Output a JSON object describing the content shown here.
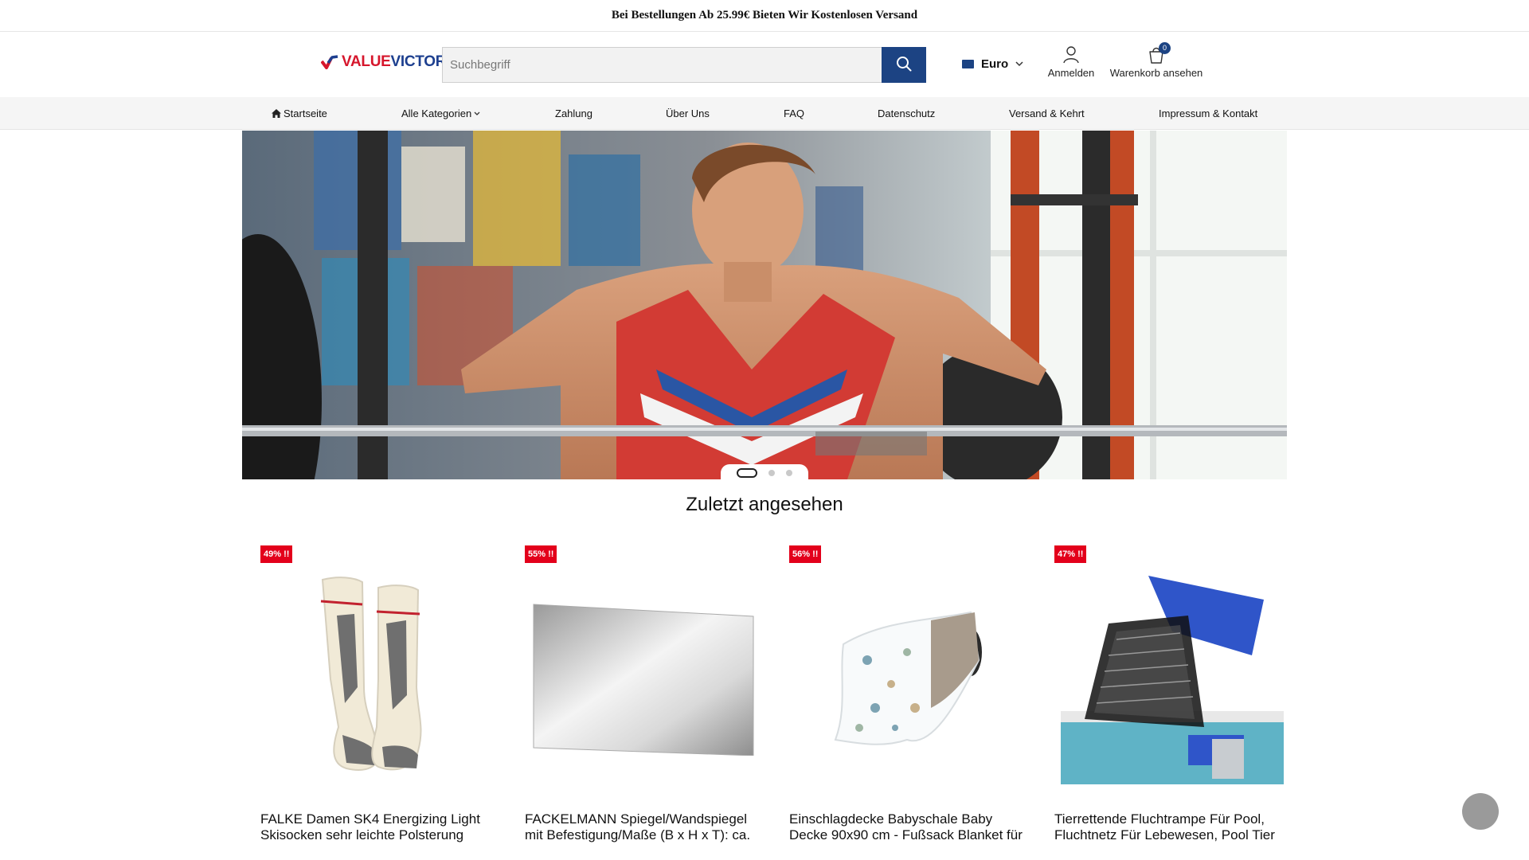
{
  "announcement": {
    "text": "Bei Bestellungen Ab 25.99€ Bieten Wir Kostenlosen Versand"
  },
  "header": {
    "logo": {
      "part1": "VALUE",
      "part2": "VICTOR"
    },
    "search": {
      "placeholder": "Suchbegriff",
      "value": ""
    },
    "currency": {
      "label": "Euro"
    },
    "account": {
      "label": "Anmelden"
    },
    "cart": {
      "label": "Warenkorb ansehen",
      "count": "0"
    }
  },
  "nav": {
    "items": [
      {
        "label": "Startseite",
        "icon": "home-icon"
      },
      {
        "label": "Alle Kategorien",
        "icon": "chevron-down-icon"
      },
      {
        "label": "Zahlung"
      },
      {
        "label": "Über Uns"
      },
      {
        "label": "FAQ"
      },
      {
        "label": "Datenschutz"
      },
      {
        "label": "Versand & Kehrt"
      },
      {
        "label": "Impressum & Kontakt"
      }
    ]
  },
  "hero": {
    "slides": 3,
    "active_slide": 1
  },
  "recently_viewed": {
    "title": "Zuletzt angesehen",
    "products": [
      {
        "badge": "49% !!",
        "name": "FALKE Damen SK4 Energizing Light Skisocken sehr leichte Polsterung"
      },
      {
        "badge": "55% !!",
        "name": "FACKELMANN Spiegel/Wandspiegel mit Befestigung/Maße (B x H x T): ca."
      },
      {
        "badge": "56% !!",
        "name": "Einschlagdecke Babyschale Baby Decke 90x90 cm - Fußsack Blanket für"
      },
      {
        "badge": "47% !!",
        "name": "Tierrettende Fluchtrampe Für Pool, Fluchtnetz Für Lebewesen, Pool Tier"
      }
    ]
  },
  "colors": {
    "primary": "#1c4383",
    "sale_badge": "#e3001b",
    "logo_red": "#d6162c"
  }
}
